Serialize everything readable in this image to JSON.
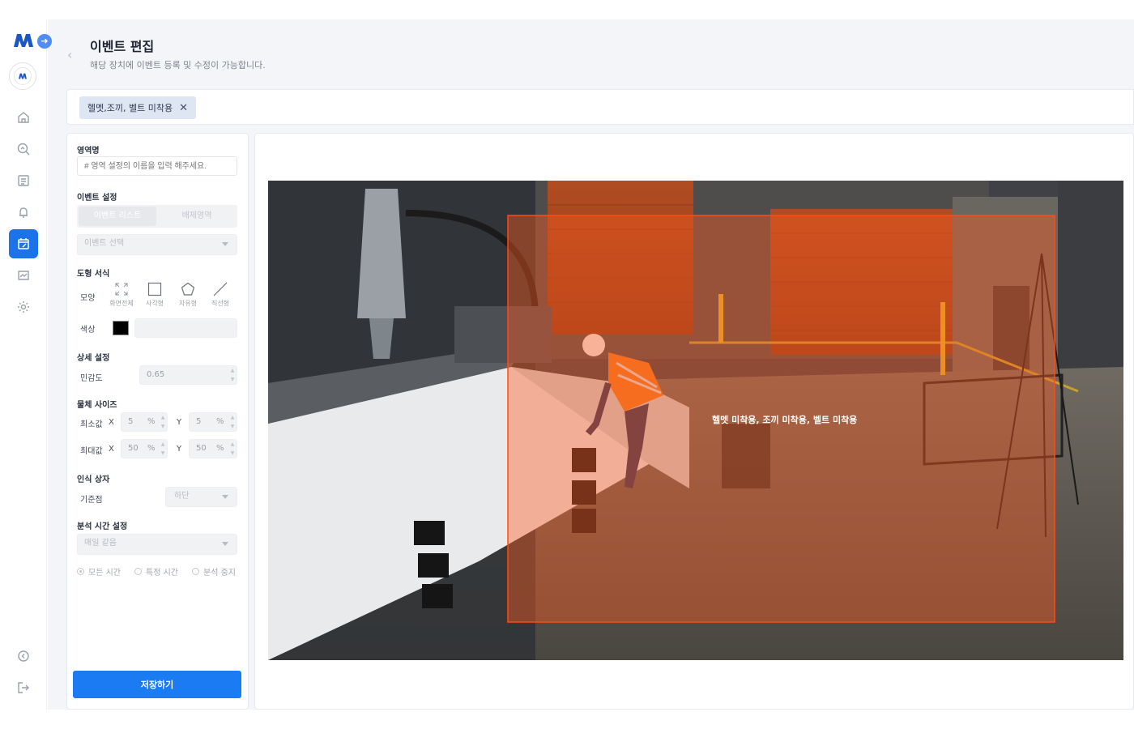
{
  "page": {
    "title": "이벤트 편집",
    "subtitle": "해당 장치에 이벤트 등록 및 수정이 가능합니다."
  },
  "tags": [
    {
      "label": "헬멧,조끼, 벨트 미착용"
    }
  ],
  "panel": {
    "region_name_label": "영역명",
    "region_name_placeholder": "# 영역 설정의 이름을 입력 해주세요.",
    "event_setting_label": "이벤트 설정",
    "tab_event_list": "이벤트 리스트",
    "tab_exclude_area": "배제영역",
    "event_select_placeholder": "이벤트 선택",
    "shape_style_label": "도형 서식",
    "shape_label": "모양",
    "shape_tools": [
      "화면전체",
      "사각형",
      "자유형",
      "직선형"
    ],
    "color_label": "색상",
    "color_value": "#000000",
    "detail_setting_label": "상세 설정",
    "sensitivity_label": "민감도",
    "sensitivity_value": "0.65",
    "object_size_label": "물체 사이즈",
    "min_label": "최소값",
    "max_label": "최대값",
    "x_label": "X",
    "y_label": "Y",
    "unit": "%",
    "min_x": "5",
    "min_y": "5",
    "max_x": "50",
    "max_y": "50",
    "detect_box_label": "인식 상자",
    "reference_label": "기준점",
    "reference_value": "하단",
    "analysis_time_label": "분석 시간 설정",
    "analysis_time_value": "매일 같음",
    "radio_all_time": "모든 시간",
    "radio_specific_time": "특정 시간",
    "radio_stop_analysis": "분석 중지",
    "save_button": "저장하기"
  },
  "canvas": {
    "zone_label": "헬멧 미착용, 조끼 미착용, 벨트 미착용",
    "zone_color": "#ff5a1f"
  },
  "colors": {
    "primary": "#1a7bf2",
    "active_nav": "#1a73e8"
  },
  "icons": {
    "nav": [
      "home-icon",
      "search-analytics-icon",
      "list-icon",
      "alarm-settings-icon",
      "event-edit-icon",
      "report-icon",
      "gear-icon",
      "collapse-icon",
      "logout-icon"
    ]
  }
}
